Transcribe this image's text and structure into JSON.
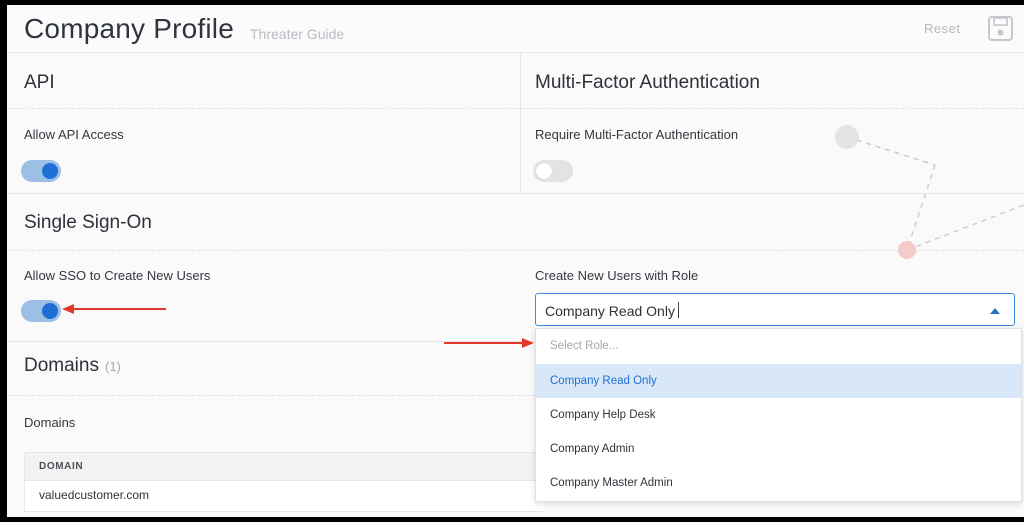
{
  "header": {
    "title": "Company Profile",
    "subtitle": "Threater Guide",
    "reset_label": "Reset",
    "save_icon": "save-icon"
  },
  "api": {
    "title": "API",
    "allow_label": "Allow API Access",
    "allow_enabled": true
  },
  "mfa": {
    "title": "Multi-Factor Authentication",
    "require_label": "Require Multi-Factor Authentication",
    "require_enabled": false
  },
  "sso": {
    "title": "Single Sign-On",
    "allow_label": "Allow SSO to Create New Users",
    "allow_enabled": true,
    "role_label": "Create New Users with Role",
    "role_value": "Company Read Only",
    "role_options": [
      {
        "label": "Select Role...",
        "placeholder": true
      },
      {
        "label": "Company Read Only",
        "selected": true
      },
      {
        "label": "Company Help Desk"
      },
      {
        "label": "Company Admin"
      },
      {
        "label": "Company Master Admin"
      }
    ]
  },
  "domains": {
    "title": "Domains",
    "count": "(1)",
    "field_label": "Domains",
    "table": {
      "columns": [
        "DOMAIN"
      ],
      "rows": [
        [
          "valuedcustomer.com"
        ]
      ]
    }
  },
  "colors": {
    "accent": "#1d6fd4",
    "toggle_on_track": "#9cbfe6",
    "selected_option_bg": "#d8e8f9",
    "annotation_arrow": "#e5382a"
  }
}
